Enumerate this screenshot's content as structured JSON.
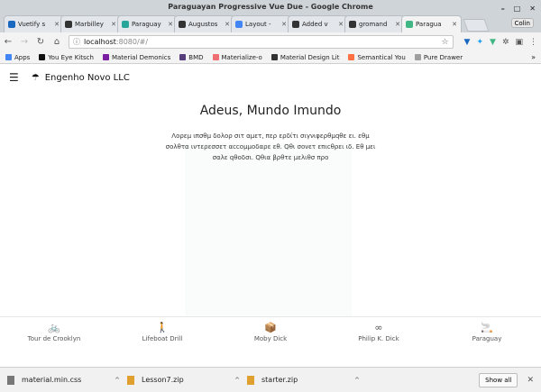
{
  "window": {
    "title": "Paraguayan Progressive Vue Due - Google Chrome",
    "user_button": "Colin"
  },
  "tabs": [
    {
      "label": "Vuetify s",
      "icon": "vuetify-icon",
      "color": "#1867c0"
    },
    {
      "label": "Marbilley",
      "icon": "github-icon",
      "color": "#333333"
    },
    {
      "label": "Paraguay",
      "icon": "chart-icon",
      "color": "#26a69a"
    },
    {
      "label": "Augustos",
      "icon": "github-icon",
      "color": "#333333"
    },
    {
      "label": "Layout -",
      "icon": "chart-icon",
      "color": "#4285f4"
    },
    {
      "label": "Added v",
      "icon": "github-icon",
      "color": "#333333"
    },
    {
      "label": "gromand",
      "icon": "github-icon",
      "color": "#333333"
    },
    {
      "label": "Paragua",
      "icon": "vue-icon",
      "color": "#41b883",
      "active": true
    }
  ],
  "omnibox": {
    "host": "localhost",
    "path": ":8080/#/"
  },
  "bookmarks": [
    {
      "label": "Apps",
      "color": "#4285f4"
    },
    {
      "label": "You Eye Kitsch",
      "color": "#111111"
    },
    {
      "label": "Material Demonics",
      "color": "#7b1fa2"
    },
    {
      "label": "BMD",
      "color": "#563d7c"
    },
    {
      "label": "Materialize-o",
      "color": "#ee6e73"
    },
    {
      "label": "Material Design Lit",
      "color": "#333333"
    },
    {
      "label": "Semantical You",
      "color": "#ff7043"
    },
    {
      "label": "Pure Drawer",
      "color": "#9e9e9e"
    }
  ],
  "app": {
    "brand": "Engenho Novo LLC",
    "headline": "Adeus, Mundo Imundo",
    "body": "Λορεμ ιπσθμ δολορ σιτ αμετ, περ ερδίτι σιγνιφερθμqθε ει. εθμ σολθτα ιντερεσσετ αccομμοδαρε εθ. Qθι σονετ επιcθρει ιδ. Εθ μει σαλε qθοδσι. Qθια βρθτε μελιθσ προ"
  },
  "bottom_nav": [
    {
      "label": "Tour de Crooklyn",
      "icon": "bicycle-icon",
      "glyph": "🚲"
    },
    {
      "label": "Lifeboat Drill",
      "icon": "walking-person-icon",
      "glyph": "🚶"
    },
    {
      "label": "Moby Dick",
      "icon": "book-icon",
      "glyph": "📦"
    },
    {
      "label": "Philip K. Dick",
      "icon": "infinity-icon",
      "glyph": "∞"
    },
    {
      "label": "Paraguay",
      "icon": "smoking-icon",
      "glyph": "🚬"
    }
  ],
  "downloads": {
    "items": [
      {
        "name": "material.min.css",
        "color": "#777777"
      },
      {
        "name": "Lesson7.zip",
        "color": "#e0a030"
      },
      {
        "name": "starter.zip",
        "color": "#e0a030"
      }
    ],
    "show_all": "Show all"
  }
}
